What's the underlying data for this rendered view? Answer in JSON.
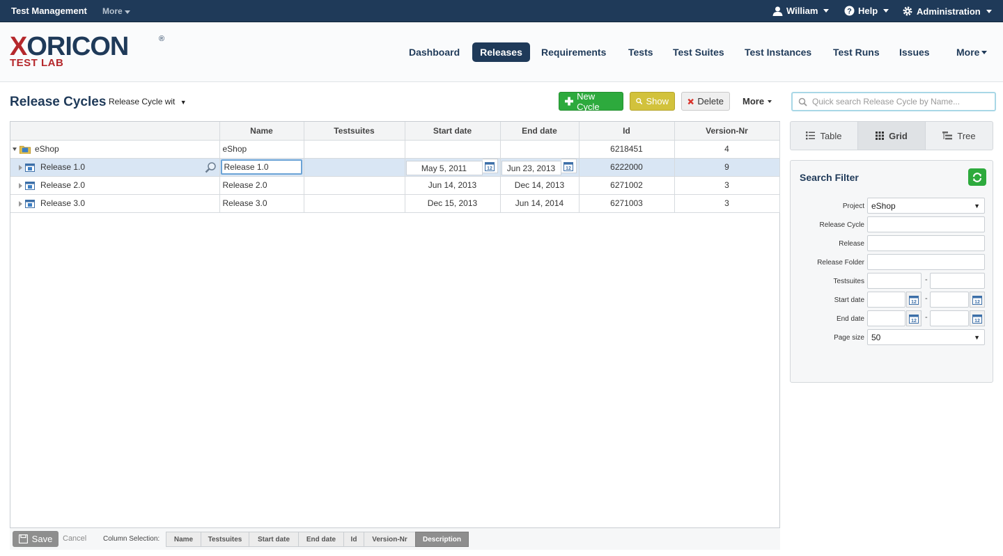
{
  "topbar": {
    "app_title": "Test Management",
    "more_label": "More",
    "user_label": "William",
    "help_label": "Help",
    "admin_label": "Administration"
  },
  "logo": {
    "line1_first": "X",
    "line1_rest": "ORICON",
    "registered": "®",
    "line2": "TEST LAB"
  },
  "nav": {
    "items": [
      "Dashboard",
      "Releases",
      "Requirements",
      "Tests",
      "Test Suites",
      "Test Instances",
      "Test Runs",
      "Issues",
      "More"
    ],
    "active": "Releases"
  },
  "toolbar": {
    "page_title": "Release Cycles",
    "view_selector": "Release Cycle wit",
    "new_label": "New Cycle",
    "show_label": "Show",
    "delete_label": "Delete",
    "more_label": "More",
    "search_placeholder": "Quick search Release Cycle by Name..."
  },
  "grid": {
    "columns": [
      "",
      "Name",
      "Testsuites",
      "Start date",
      "End date",
      "Id",
      "Version-Nr"
    ],
    "rows": [
      {
        "tree": "eShop",
        "name": "eShop",
        "testsuites": "",
        "start": "",
        "end": "",
        "id": "6218451",
        "version": "4"
      },
      {
        "tree": "Release 1.0",
        "name": "Release 1.0",
        "testsuites": "",
        "start": "May 5, 2011",
        "end": "Jun 23, 2013",
        "id": "6222000",
        "version": "9"
      },
      {
        "tree": "Release 2.0",
        "name": "Release 2.0",
        "testsuites": "",
        "start": "Jun 14, 2013",
        "end": "Dec 14, 2013",
        "id": "6271002",
        "version": "3"
      },
      {
        "tree": "Release 3.0",
        "name": "Release 3.0",
        "testsuites": "",
        "start": "Dec 15, 2013",
        "end": "Jun 14, 2014",
        "id": "6271003",
        "version": "3"
      }
    ]
  },
  "bottombar": {
    "save_label": "Save",
    "cancel_label": "Cancel",
    "column_selection_label": "Column Selection:",
    "columns": [
      "Name",
      "Testsuites",
      "Start date",
      "End date",
      "Id",
      "Version-Nr",
      "Description"
    ]
  },
  "viewtabs": {
    "table": "Table",
    "grid": "Grid",
    "tree": "Tree",
    "active": "Grid"
  },
  "filter": {
    "title": "Search Filter",
    "project_label": "Project",
    "project_value": "eShop",
    "release_cycle_label": "Release Cycle",
    "release_label": "Release",
    "release_folder_label": "Release Folder",
    "testsuites_label": "Testsuites",
    "start_date_label": "Start date",
    "end_date_label": "End date",
    "page_size_label": "Page size",
    "page_size_value": "50",
    "range_separator": "-"
  },
  "colors": {
    "brand_navy": "#1f3a59",
    "brand_red": "#b5282c",
    "new_green": "#2daa3d",
    "show_yellow": "#d2c23c",
    "selection_blue": "#d9e6f4"
  }
}
